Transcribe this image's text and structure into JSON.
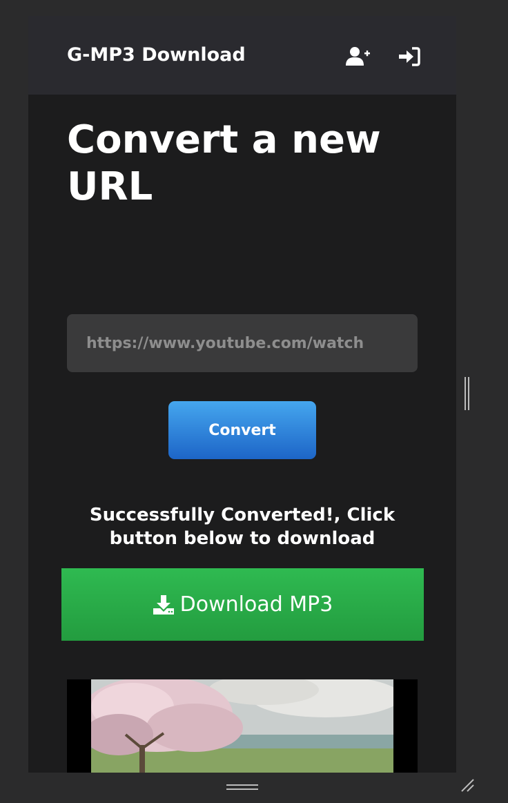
{
  "navbar": {
    "brand": "G-MP3 Download",
    "icons": [
      "user-plus-icon",
      "sign-in-icon"
    ]
  },
  "main": {
    "title": "Convert a new URL",
    "url_input": {
      "value": "",
      "placeholder": "https://www.youtube.com/watch"
    },
    "convert_label": "Convert",
    "success_message": "Successfully Converted!, Click button below to download",
    "download_label": "Download MP3",
    "download_icon": "download-icon"
  },
  "colors": {
    "navbar_bg": "#2a2a2f",
    "page_bg": "#1c1c1d",
    "convert_blue": "#3b8fe0",
    "download_green": "#2db34d"
  }
}
